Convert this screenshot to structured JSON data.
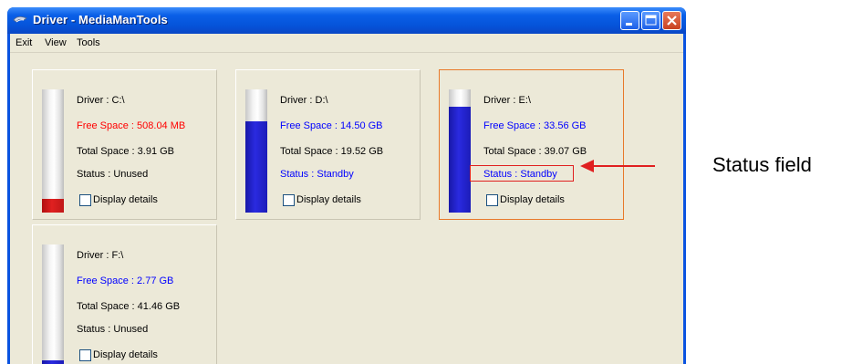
{
  "window": {
    "title": "Driver - MediaManTools"
  },
  "menu": [
    "Exit",
    "View",
    "Tools"
  ],
  "drives": [
    {
      "driver": "Driver : C:\\",
      "free": "Free Space : 508.04 MB",
      "total": "Total Space : 3.91 GB",
      "status": "Status : Unused",
      "details_label": "Display details",
      "used_fraction": 0.11,
      "free_color": "#ff0000",
      "status_color": "#000000",
      "fill_color": "red"
    },
    {
      "driver": "Driver : D:\\",
      "free": "Free Space : 14.50 GB",
      "total": "Total Space : 19.52 GB",
      "status": "Status : Standby",
      "details_label": "Display details",
      "used_fraction": 0.74,
      "free_color": "#0000ff",
      "status_color": "#0000ff",
      "fill_color": "blue"
    },
    {
      "driver": "Driver : E:\\",
      "free": "Free Space : 33.56 GB",
      "total": "Total Space : 39.07 GB",
      "status": "Status : Standby",
      "details_label": "Display details",
      "used_fraction": 0.86,
      "free_color": "#0000ff",
      "status_color": "#0000ff",
      "fill_color": "blue",
      "selected": true
    },
    {
      "driver": "Driver : F:\\",
      "free": "Free Space : 2.77 GB",
      "total": "Total Space : 41.46 GB",
      "status": "Status : Unused",
      "details_label": "Display details",
      "used_fraction": 0.06,
      "free_color": "#0000ff",
      "status_color": "#000000",
      "fill_color": "blue"
    }
  ],
  "annotation": {
    "text": "Status field",
    "color": "#e02020"
  }
}
